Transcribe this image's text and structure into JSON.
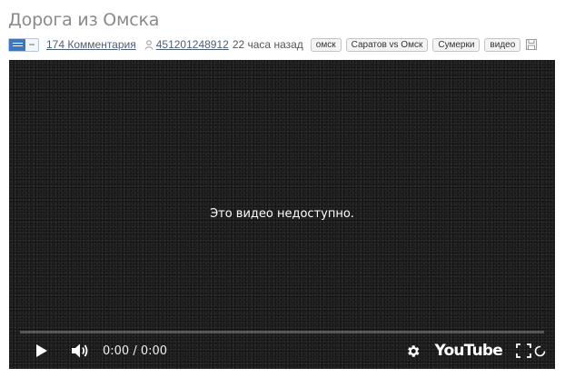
{
  "post": {
    "title": "Дорога из Омска",
    "comments_link": "174 Комментария",
    "author": "451201248912",
    "time": "22 часа назад",
    "toggle_minus": "−"
  },
  "tags": [
    "омск",
    "Саратов vs Омск",
    "Сумерки",
    "видео"
  ],
  "video": {
    "message": "Это видео недоступно.",
    "time_display": "0:00 / 0:00",
    "brand": "YouTube"
  }
}
